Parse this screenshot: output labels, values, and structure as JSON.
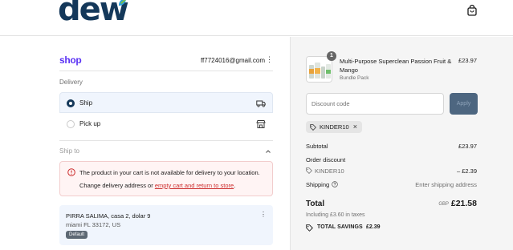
{
  "header": {
    "logo_text": "dew",
    "brand_color": "#14385a",
    "leaf_colors": [
      "#2f9fd8",
      "#7cc242"
    ],
    "cart_icon": "shopping-bag-icon"
  },
  "account": {
    "shop_label": "shop",
    "shop_color": "#5a31f4",
    "email": "ff7724016@gmail.com",
    "menu_icon": "kebab-menu-icon"
  },
  "delivery": {
    "heading": "Delivery",
    "options": [
      {
        "label": "Ship",
        "selected": true,
        "icon": "truck-icon"
      },
      {
        "label": "Pick up",
        "selected": false,
        "icon": "store-icon"
      }
    ]
  },
  "ship_to": {
    "heading": "Ship to",
    "toggle_icon": "chevron-up-icon",
    "alert": {
      "icon": "error-circle-icon",
      "message": "The product in your cart is not available for delivery to your location.",
      "action_prefix": "Change delivery address or ",
      "action_link": "empty cart and return to store",
      "action_suffix": ".",
      "color": "#cc2c2c"
    },
    "address": {
      "line1": "PIRRA SALIMA, casa 2, dolar 9",
      "line2": "miami FL 33172, US",
      "badge": "Default"
    }
  },
  "summary": {
    "item": {
      "quantity": "1",
      "name": "Multi-Purpose Superclean Passion Fruit & Mango",
      "variant": "Bundle Pack",
      "price": "£23.97"
    },
    "discount": {
      "placeholder": "Discount code",
      "apply_label": "Apply",
      "applied_code": "KINDER10"
    },
    "subtotal_label": "Subtotal",
    "subtotal_value": "£23.97",
    "order_discount_label": "Order discount",
    "discount_code_label": "KINDER10",
    "discount_value": "– £2.39",
    "shipping_label": "Shipping",
    "shipping_value": "Enter shipping address",
    "total_label": "Total",
    "currency": "GBP",
    "total_value": "£21.58",
    "taxes_note": "Including £3.60 in taxes",
    "savings_label": "TOTAL SAVINGS",
    "savings_value": "£2.39"
  }
}
